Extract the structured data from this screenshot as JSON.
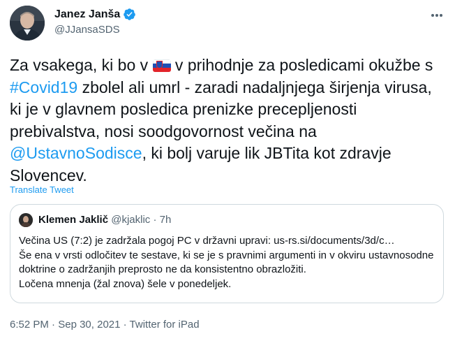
{
  "author": {
    "name": "Janez Janša",
    "handle": "@JJansaSDS",
    "verified_icon": "verified-badge-icon",
    "accent": "#1d9bf0"
  },
  "tweet": {
    "part1": "Za vsakega, ki bo v ",
    "flag": "slovenia-flag-icon",
    "part2": " v prihodnje za posledicami okužbe s ",
    "hashtag": "#Covid19",
    "part3": " zbolel ali umrl - zaradi nadaljnjega širjenja virusa, ki je v glavnem posledica prenizke precepljenosti prebivalstva, nosi soodgovornost večina na ",
    "mention": "@UstavnoSodisce",
    "part4": ", ki bolj varuje lik JBTita kot zdravje Slovencev."
  },
  "translate_label": "Translate Tweet",
  "quote": {
    "name": "Klemen Jaklič",
    "handle": "@kjaklic",
    "separator": "·",
    "time": "7h",
    "line1": "Večina US (7:2) je zadržala pogoj PC v državni upravi: us-rs.si/documents/3d/c…",
    "line2": "Še ena v vrsti odločitev te sestave, ki se je s pravnimi argumenti in v okviru ustavnosodne doktrine o zadržanjih preprosto ne da konsistentno obrazložiti.",
    "line3": "Ločena mnenja (žal znova) šele v ponedeljek."
  },
  "footer": {
    "time": "6:52 PM",
    "dot": "·",
    "date": "Sep 30, 2021",
    "source": "Twitter for iPad"
  }
}
